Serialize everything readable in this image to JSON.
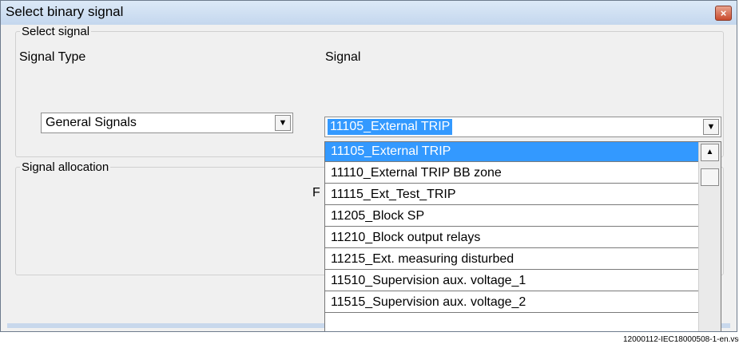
{
  "window": {
    "title": "Select binary signal",
    "close_glyph": "×"
  },
  "select_signal": {
    "legend": "Select signal",
    "signal_type_label": "Signal Type",
    "signal_label": "Signal",
    "signal_type_value": "General Signals",
    "signal_value": "11105_External TRIP"
  },
  "signal_allocation": {
    "legend": "Signal allocation",
    "partial_text": "F"
  },
  "dropdown": {
    "items": [
      "11105_External TRIP",
      "11110_External TRIP BB zone",
      "11115_Ext_Test_TRIP",
      "11205_Block SP",
      "11210_Block output relays",
      "11215_Ext. measuring disturbed",
      "11510_Supervision aux. voltage_1",
      "11515_Supervision aux. voltage_2"
    ],
    "selected_index": 0
  },
  "caption": "12000112-IEC18000508-1-en.vsd",
  "icons": {
    "combo_arrow": "chevron-down-icon",
    "scroll_up": "scroll-up-icon",
    "close": "close-icon"
  },
  "colors": {
    "selection": "#3399ff",
    "title_gradient_top": "#dce9f7",
    "close_button": "#c94a2c"
  }
}
